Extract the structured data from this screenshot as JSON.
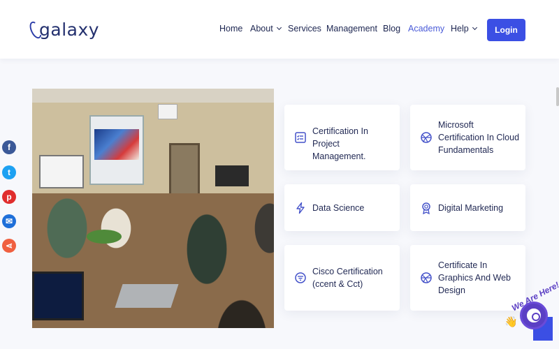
{
  "brand": {
    "name": "galaxy"
  },
  "nav": {
    "items": [
      {
        "label": "Home",
        "has_dropdown": false,
        "active": false
      },
      {
        "label": "About",
        "has_dropdown": true,
        "active": false
      },
      {
        "label": "Services",
        "has_dropdown": false,
        "active": false
      },
      {
        "label": "Management",
        "has_dropdown": false,
        "active": false
      },
      {
        "label": "Blog",
        "has_dropdown": false,
        "active": false
      },
      {
        "label": "Academy",
        "has_dropdown": false,
        "active": true
      },
      {
        "label": "Help",
        "has_dropdown": true,
        "active": false
      }
    ],
    "login_label": "Login"
  },
  "colors": {
    "accent": "#3b4fe4",
    "active_nav": "#4a5bd8",
    "text_dark": "#1c2550",
    "icon": "#4351c9",
    "chat_purple": "#5b3fc4"
  },
  "courses": [
    {
      "title": "Certification In Project Management.",
      "icon": "certificate-list-icon"
    },
    {
      "title": "Microsoft Certification In Cloud Fundamentals",
      "icon": "basketball-globe-icon"
    },
    {
      "title": "Data Science",
      "icon": "lightning-icon"
    },
    {
      "title": "Digital Marketing",
      "icon": "award-medal-icon"
    },
    {
      "title": "Cisco Certification (ccent & Cct)",
      "icon": "filter-lines-icon"
    },
    {
      "title": "Certificate In Graphics And Web Design",
      "icon": "basketball-globe-icon"
    }
  ],
  "share": [
    {
      "network": "facebook",
      "color": "#3b5998",
      "glyph": "f"
    },
    {
      "network": "twitter",
      "color": "#1da1f2",
      "glyph": "t"
    },
    {
      "network": "pinterest",
      "color": "#e02d2d",
      "glyph": "p"
    },
    {
      "network": "email",
      "color": "#1e6fd9",
      "glyph": "✉"
    },
    {
      "network": "share",
      "color": "#f06040",
      "glyph": "⋖"
    }
  ],
  "chat": {
    "tagline": "We Are Here!",
    "wave": "👋"
  },
  "photo": {
    "alt_icon": "classroom-photo"
  }
}
